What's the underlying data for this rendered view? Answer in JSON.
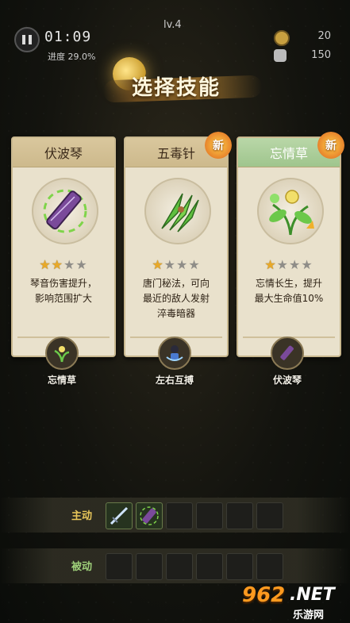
{
  "hud": {
    "timer": "01:09",
    "progress": "进度 29.0%",
    "level": "lv.4",
    "coins": "20",
    "kills": "150"
  },
  "title": "选择技能",
  "cards": [
    {
      "name": "伏波琴",
      "icon": "guqin-icon",
      "stars": 2,
      "max_stars": 4,
      "desc_lines": [
        "琴音伤害提升，",
        "影响范围扩大"
      ],
      "is_new": false,
      "theme": "tan",
      "combo_icon": "herb-icon",
      "combo_label": "忘情草"
    },
    {
      "name": "五毒针",
      "icon": "poison-needles-icon",
      "stars": 1,
      "max_stars": 4,
      "desc_lines": [
        "唐门秘法，可向",
        "最近的敌人发射",
        "淬毒暗器"
      ],
      "is_new": true,
      "new_label": "新",
      "theme": "tan",
      "combo_icon": "dual-fighter-icon",
      "combo_label": "左右互搏"
    },
    {
      "name": "忘情草",
      "icon": "herb-icon",
      "stars": 1,
      "max_stars": 4,
      "desc_lines": [
        "忘情长生，提升",
        "最大生命值10%"
      ],
      "is_new": true,
      "new_label": "新",
      "theme": "green",
      "combo_icon": "guqin-icon",
      "combo_label": "伏波琴"
    }
  ],
  "active_bar": {
    "label": "主动",
    "slots": [
      "sword-icon",
      "guqin-icon",
      "",
      "",
      "",
      ""
    ]
  },
  "passive_bar": {
    "label": "被动",
    "slots": [
      "",
      "",
      "",
      "",
      "",
      ""
    ]
  },
  "watermark": {
    "brand": "962",
    "domain": ".NET",
    "sub": "乐游网"
  },
  "colors": {
    "gold": "#e8a929",
    "new_badge": "#e7832b",
    "green_header": "#9fc58d",
    "tan_header": "#cdb98c"
  }
}
